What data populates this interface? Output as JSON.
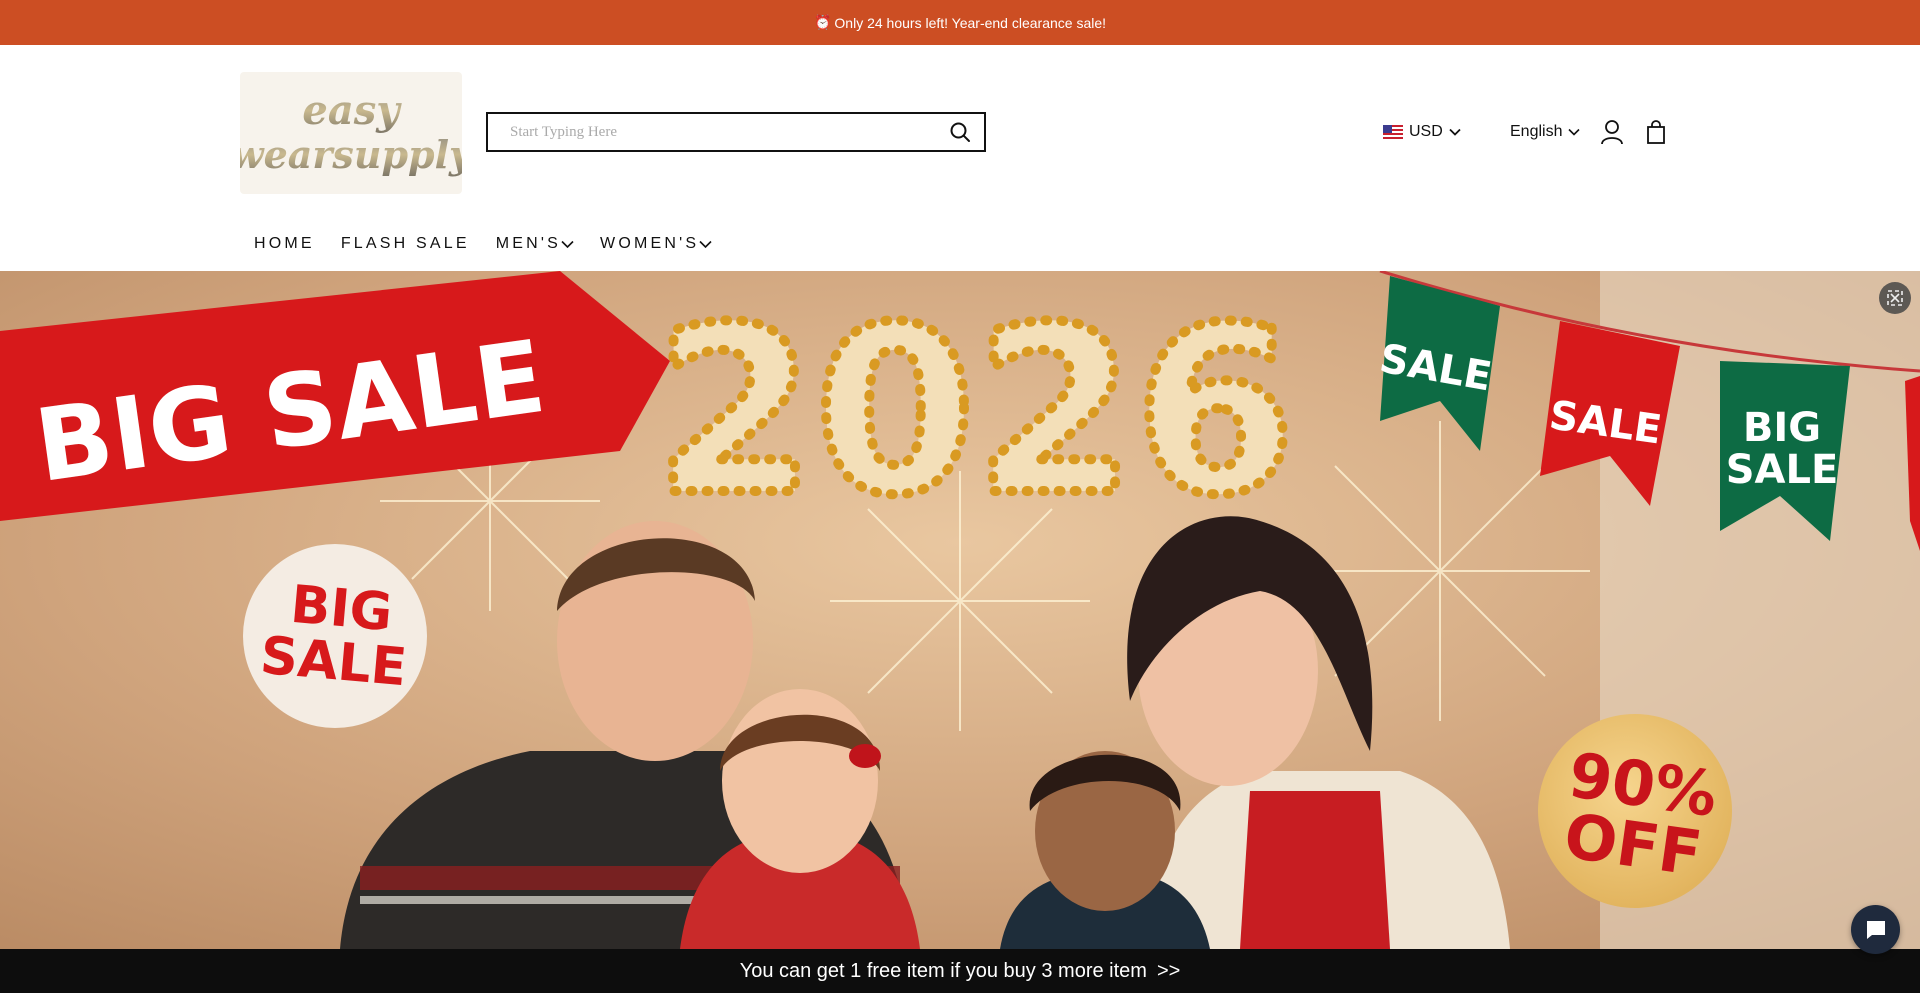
{
  "announcement": {
    "icon": "alarm-clock-icon",
    "text": "Only 24 hours left! Year-end clearance sale!"
  },
  "logo": {
    "line1": "easy",
    "line2": "wearsupply"
  },
  "search": {
    "placeholder": "Start Typing Here",
    "icon": "search-icon"
  },
  "currency": {
    "flag": "us-flag-icon",
    "value": "USD"
  },
  "language": {
    "value": "English"
  },
  "header_icons": [
    "account-icon",
    "shopping-bag-icon"
  ],
  "nav": {
    "items": [
      {
        "label": "HOME",
        "dropdown": false
      },
      {
        "label": "FLASH SALE",
        "dropdown": false
      },
      {
        "label": "MEN'S",
        "dropdown": true
      },
      {
        "label": "WOMEN'S",
        "dropdown": true
      }
    ]
  },
  "hero": {
    "ribbon": "BIG SALE",
    "year": "2026",
    "badge_left": [
      "BIG",
      "SALE"
    ],
    "badge_right": [
      "90%",
      "OFF"
    ],
    "pennants": [
      [
        "SALE"
      ],
      [
        "SALE"
      ],
      [
        "BIG",
        "SALE"
      ]
    ]
  },
  "promo_bar": {
    "text": "You can get 1 free item if you buy 3 more item",
    "arrow": ">>"
  },
  "colors": {
    "announce_bg": "#cc4e23",
    "promo_bg": "#0d0d0d",
    "ribbon_red": "#d7191b",
    "pennant_green": "#0d6b44"
  }
}
